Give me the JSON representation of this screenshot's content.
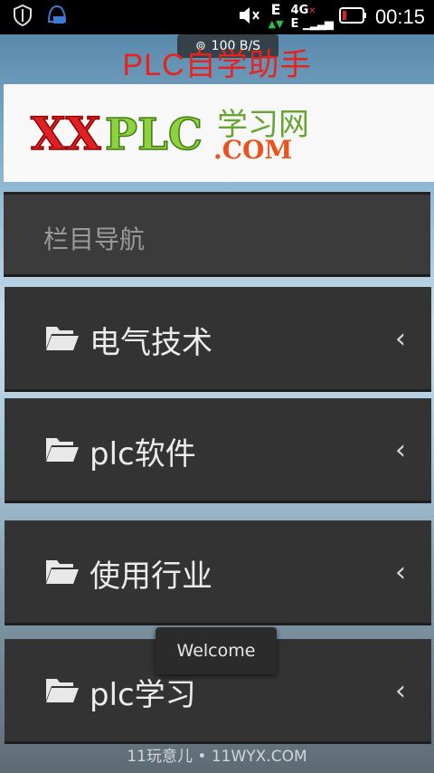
{
  "status_bar": {
    "time": "00:15",
    "network": "4G",
    "signal_letter": "E"
  },
  "net_speed": "100 B/S",
  "app_title": "PLC自学助手",
  "banner": {
    "left_text": "XX",
    "middle_text": "PLC",
    "top_right_text": "学习网",
    "bottom_right_text": ".COM"
  },
  "nav": {
    "header": "栏目导航",
    "items": [
      {
        "label": "电气技术"
      },
      {
        "label": "plc软件"
      },
      {
        "label": "使用行业"
      },
      {
        "label": "plc学习"
      }
    ]
  },
  "toast": "Welcome",
  "watermark": "11玩意儿 • 11WYX.COM"
}
